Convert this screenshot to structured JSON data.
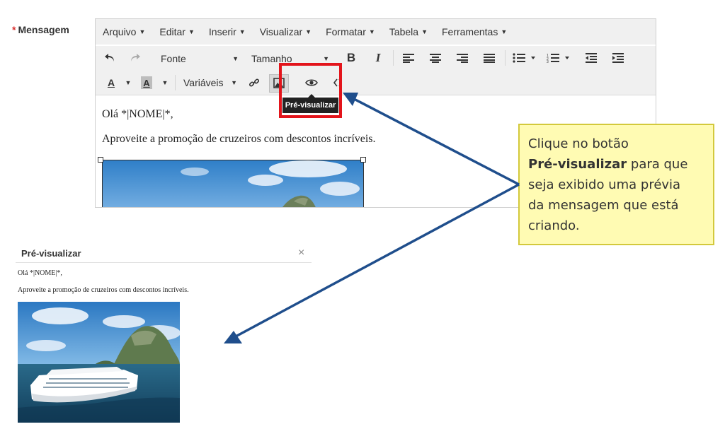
{
  "field": {
    "required_mark": "*",
    "label": "Mensagem"
  },
  "menubar": {
    "items": [
      {
        "label": "Arquivo"
      },
      {
        "label": "Editar"
      },
      {
        "label": "Inserir"
      },
      {
        "label": "Visualizar"
      },
      {
        "label": "Formatar"
      },
      {
        "label": "Tabela"
      },
      {
        "label": "Ferramentas"
      }
    ]
  },
  "toolbar": {
    "font_select": "Fonte",
    "size_select": "Tamanho",
    "variables_select": "Variáveis",
    "bold_label": "B",
    "italic_label": "I",
    "text_color_label": "A",
    "bg_color_label": "A"
  },
  "tooltip": {
    "label": "Pré-visualizar"
  },
  "editor_content": {
    "greeting": "Olá *|NOME|*,",
    "promo": "Aproveite a promoção de cruzeiros com descontos incríveis."
  },
  "callout": {
    "line1": "Clique no botão",
    "bold": "Pré-visualizar",
    "line2": " para que",
    "line3": "seja exibido uma prévia",
    "line4": "da mensagem que está",
    "line5": "criando."
  },
  "preview": {
    "title": "Pré-visualizar",
    "close": "×",
    "greeting": "Olá *|NOME|*,",
    "promo": "Aproveite a promoção de cruzeiros com descontos incríveis."
  },
  "colors": {
    "highlight": "#e3141b",
    "arrow": "#1f4e8c",
    "callout_bg": "#fffbb3",
    "required": "#d9302e"
  },
  "icons": {
    "undo": "undo-icon",
    "redo": "redo-icon",
    "link": "link-icon",
    "image": "image-icon",
    "preview": "eye-icon",
    "code": "code-icon"
  }
}
